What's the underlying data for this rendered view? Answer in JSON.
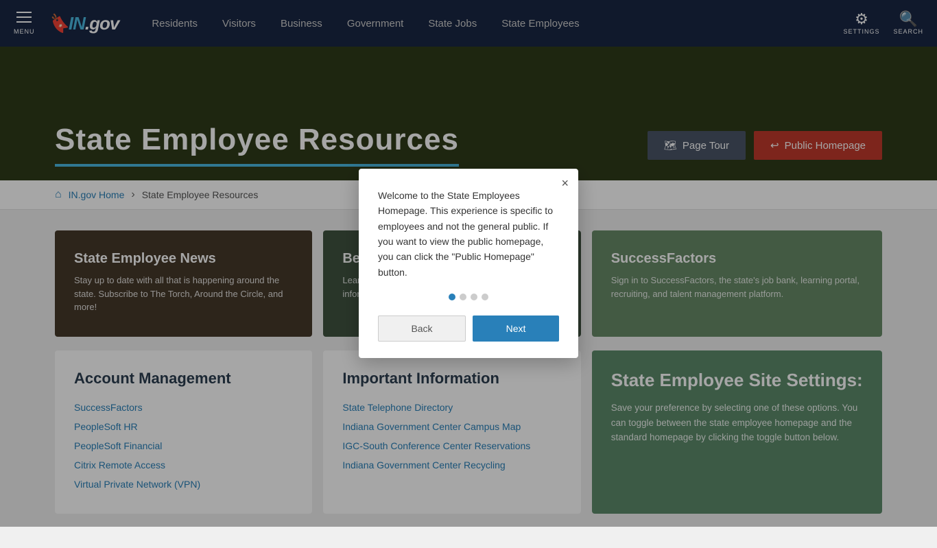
{
  "nav": {
    "menu_label": "MENU",
    "logo": "IN.gov",
    "links": [
      {
        "label": "Residents",
        "id": "residents"
      },
      {
        "label": "Visitors",
        "id": "visitors"
      },
      {
        "label": "Business",
        "id": "business"
      },
      {
        "label": "Government",
        "id": "government"
      },
      {
        "label": "State Jobs",
        "id": "state-jobs"
      },
      {
        "label": "State Employees",
        "id": "state-employees"
      }
    ],
    "settings_label": "SETTINGS",
    "search_label": "SEARCH"
  },
  "hero": {
    "title": "State Employee Resources",
    "page_tour_label": "Page Tour",
    "public_homepage_label": "Public Homepage"
  },
  "breadcrumb": {
    "home_label": "IN.gov Home",
    "current": "State Employee Resources"
  },
  "cards_row1": [
    {
      "id": "news",
      "title": "State Employee News",
      "description": "Stay up to date with all that is happening around the state. Subscribe to The Torch, Around the Circle, and more!"
    },
    {
      "id": "middle",
      "title": "Benefits",
      "description": "Learn about your benefits and other employee information."
    },
    {
      "id": "sf",
      "title": "SuccessFactors",
      "description": "Sign in to SuccessFactors, the state's job bank, learning portal, recruiting, and talent management platform."
    }
  ],
  "cards_row2": [
    {
      "id": "account",
      "title": "Account Management",
      "links": [
        "SuccessFactors",
        "PeopleSoft HR",
        "PeopleSoft Financial",
        "Citrix Remote Access",
        "Virtual Private Network (VPN)"
      ]
    },
    {
      "id": "important",
      "title": "Important Information",
      "links": [
        "State Telephone Directory",
        "Indiana Government Center Campus Map",
        "IGC-South Conference Center Reservations",
        "Indiana Government Center Recycling"
      ]
    },
    {
      "id": "settings",
      "title": "State Employee Site Settings:",
      "description": "Save your preference by selecting one of these options. You can toggle between the state employee homepage and the standard homepage by clicking the toggle button below."
    }
  ],
  "modal": {
    "body": "Welcome to the State Employees Homepage. This experience is specific to employees and not the general public. If you want to view the public homepage, you can click the \"Public Homepage\" button.",
    "dots": [
      true,
      false,
      false,
      false
    ],
    "back_label": "Back",
    "next_label": "Next",
    "close_label": "×"
  }
}
